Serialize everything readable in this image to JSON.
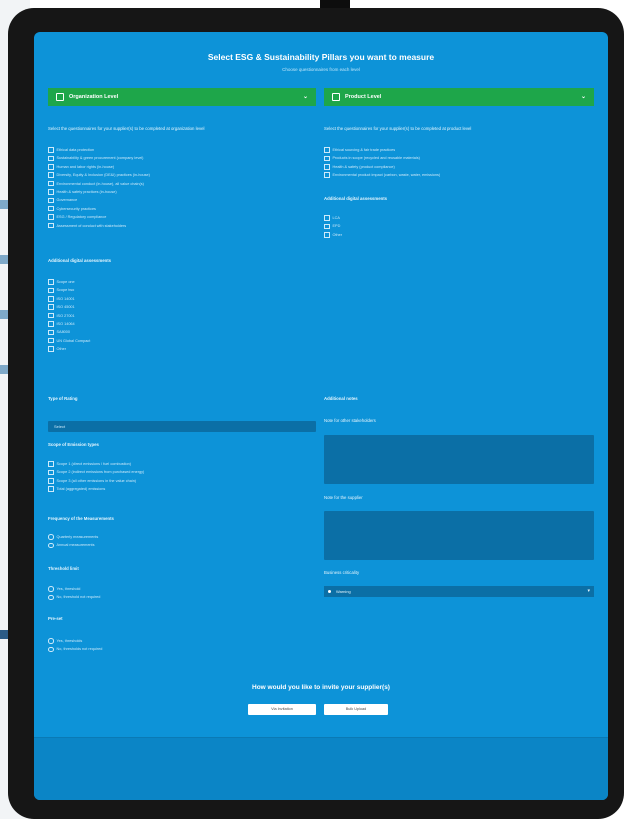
{
  "page": {
    "title": "Select ESG & Sustainability Pillars you want to measure",
    "subtitle": "Choose questionnaires from each level"
  },
  "org": {
    "header": "Organization Level",
    "question": "Select the questionnaires for your supplier(s) to be completed at organization level",
    "items": [
      "Ethical data protection",
      "Sustainability & green procurement (company level)",
      "Human and labor rights (in-house)",
      "Diversity, Equity & Inclusion (DE&I) practices (in-house)",
      "Environmental conduct (in-house), all value chain(s)",
      "Health & safety practices (in-house)",
      "Governance",
      "Cybersecurity practices",
      "ESG / Regulatory compliance",
      "Assessment of conduct with stakeholders"
    ],
    "scope_title": "Additional digital assessments",
    "scope_items": [
      "Scope one",
      "Scope two",
      "ISO 14001",
      "ISO 45001",
      "ISO 27001",
      "ISO 14064",
      "SA8000",
      "UN Global Compact",
      "Other"
    ]
  },
  "product": {
    "header": "Product Level",
    "question": "Select the questionnaires for your supplier(s) to be completed at product level",
    "items": [
      "Ethical sourcing & fair trade practices",
      "Products in scope (recycled and reusable materials)",
      "Health & safety (product compliance)",
      "Environmental product impact (carbon, waste, water, emissions)"
    ],
    "assess_title": "Additional digital assessments",
    "assess_items": [
      "LCA",
      "EPD",
      "Other"
    ]
  },
  "form": {
    "type_label": "Type of Rating",
    "type_value": "Select",
    "scope_label": "Scope of Emission types",
    "scope_items": [
      "Scope 1 (direct emissions / fuel combustion)",
      "Scope 2 (indirect emissions from purchased energy)",
      "Scope 3 (all other emissions in the value chain)",
      "Total (aggregated) emissions"
    ],
    "freq_label": "Frequency of the Measurements",
    "freq_items": [
      "Quarterly measurements",
      "Annual measurements"
    ],
    "threshold_label": "Threshold limit",
    "threshold_items": [
      "Yes, threshold",
      "No, threshold not required"
    ],
    "kpi_label": "Pre-set",
    "kpi_items": [
      "Yes, thresholds",
      "No, thresholds not required"
    ],
    "notes_label": "Additional notes",
    "notes1_label": "Note for other stakeholders",
    "notes2_label": "Note for the supplier",
    "priority_label": "Business criticality",
    "priority_value": "Warning"
  },
  "invite": {
    "title": "How would you like to invite your supplier(s)",
    "btn1": "Via Invitation",
    "btn2": "Bulk Upload"
  },
  "colors": {
    "screen": "#0d93d8",
    "header_green": "#1ea64a",
    "field": "#0b6fa6"
  }
}
